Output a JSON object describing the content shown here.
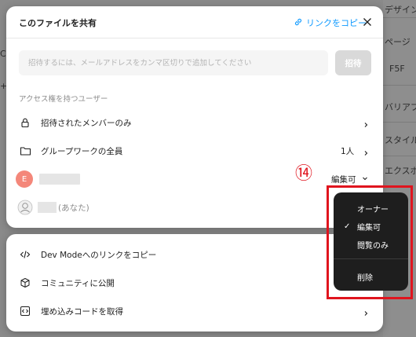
{
  "background": {
    "right_items": [
      "デザイン",
      "ページ",
      "F5F",
      "バリアブ",
      "スタイル",
      "エクスポ"
    ],
    "left_items": [
      "C",
      "+"
    ]
  },
  "dialog": {
    "title": "このファイルを共有",
    "copy_link_label": "リンクをコピー",
    "invite": {
      "placeholder": "招待するには、メールアドレスをカンマ区切りで追加してください",
      "value": "",
      "button_label": "招待"
    },
    "access_section_label": "アクセス権を持つユーザー",
    "rows": [
      {
        "label": "招待されたメンバーのみ"
      },
      {
        "label": "グループワークの全員",
        "count": "1人"
      }
    ],
    "users": [
      {
        "avatar_letter": "E",
        "permission": "編集可"
      },
      {
        "you_label": "(あなた)"
      }
    ]
  },
  "annotation": {
    "marker": "⑭",
    "color": "#e0141e"
  },
  "permission_menu": {
    "items": [
      "オーナー",
      "編集可",
      "閲覧のみ"
    ],
    "checked_item": "✓",
    "delete_label": "削除"
  },
  "bottom_panel": {
    "items": [
      {
        "label": "Dev Modeへのリンクをコピー",
        "icon": "code-icon"
      },
      {
        "label": "コミュニティに公開",
        "icon": "community-icon"
      },
      {
        "label": "埋め込みコードを取得",
        "icon": "embed-icon"
      }
    ]
  },
  "colors": {
    "accent": "#0d99ff",
    "highlight": "#e0141e",
    "menu_bg": "#1e1e1e"
  }
}
